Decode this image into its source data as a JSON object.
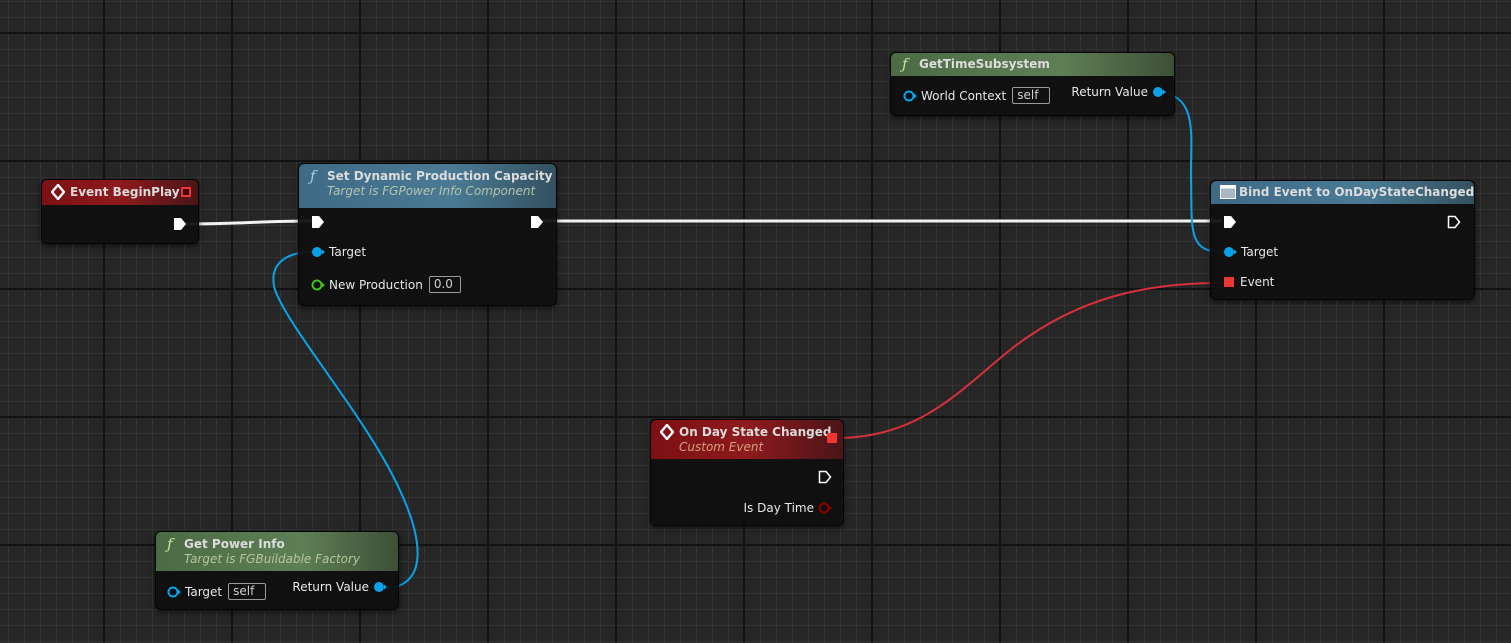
{
  "editor": {
    "type": "Blueprint Event Graph"
  },
  "colors": {
    "exec_wire": "#ffffff",
    "object_pin": "#0aa2e8",
    "float_pin": "#3ec11a",
    "delegate_pin": "#f03535",
    "bool_pin": "#8c0000",
    "event_header": "#8e1a1d",
    "function_header": "#4a7a94",
    "pure_function_header": "#5e7f55"
  },
  "nodes": {
    "event_begin_play": {
      "title": "Event BeginPlay",
      "icon": "event-diamond-icon",
      "pins": {
        "delegate": "OutputDelegate",
        "exec_out": "then"
      }
    },
    "set_dynamic_production_capacity": {
      "title": "Set Dynamic Production Capacity",
      "subtitle": "Target is FGPower Info Component",
      "icon": "function-icon",
      "pins": {
        "target_label": "Target",
        "new_production_label": "New Production",
        "new_production_value": "0.0"
      }
    },
    "get_time_subsystem": {
      "title": "GetTimeSubsystem",
      "icon": "function-icon",
      "pins": {
        "world_context_label": "World Context",
        "world_context_value": "self",
        "return_value_label": "Return Value"
      }
    },
    "bind_event": {
      "title": "Bind Event to OnDayStateChanged",
      "icon": "bind-event-icon",
      "pins": {
        "target_label": "Target",
        "event_label": "Event"
      }
    },
    "on_day_state_changed": {
      "title": "On Day State Changed",
      "subtitle": "Custom Event",
      "icon": "event-diamond-icon",
      "pins": {
        "is_day_time_label": "Is Day Time"
      }
    },
    "get_power_info": {
      "title": "Get Power Info",
      "subtitle": "Target is FGBuildable Factory",
      "icon": "function-icon",
      "pins": {
        "target_label": "Target",
        "target_value": "self",
        "return_value_label": "Return Value"
      }
    }
  },
  "connections": [
    {
      "from": "Event BeginPlay.exec_out",
      "to": "Set Dynamic Production Capacity.exec_in",
      "type": "exec"
    },
    {
      "from": "Set Dynamic Production Capacity.exec_out",
      "to": "Bind Event to OnDayStateChanged.exec_in",
      "type": "exec"
    },
    {
      "from": "Get Power Info.Return Value",
      "to": "Set Dynamic Production Capacity.Target",
      "type": "object"
    },
    {
      "from": "GetTimeSubsystem.Return Value",
      "to": "Bind Event to OnDayStateChanged.Target",
      "type": "object"
    },
    {
      "from": "On Day State Changed.delegate",
      "to": "Bind Event to OnDayStateChanged.Event",
      "type": "delegate"
    }
  ]
}
